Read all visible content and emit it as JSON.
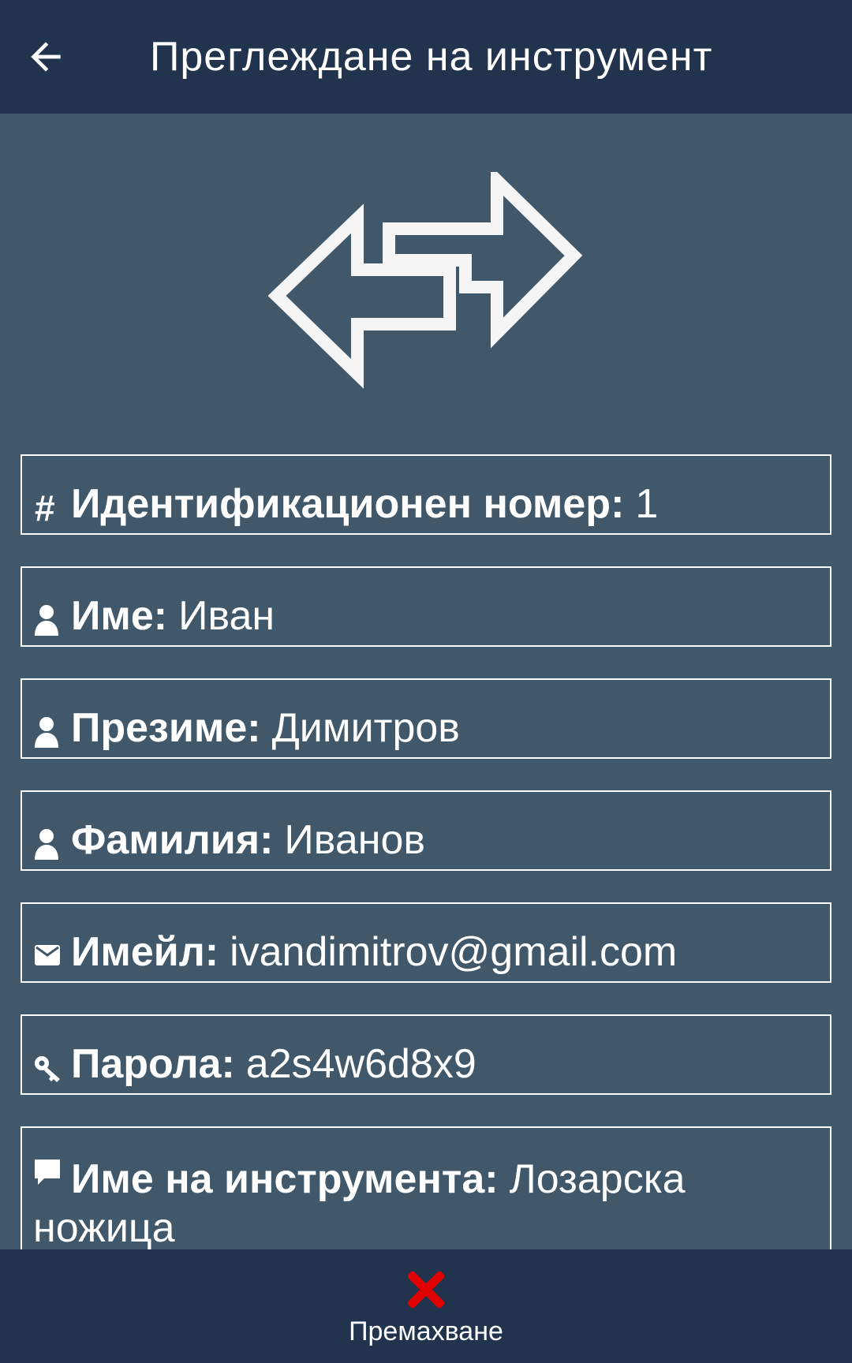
{
  "app_bar": {
    "title": "Преглеждане на инструмент",
    "back_icon": "arrow-left-icon"
  },
  "hero": {
    "icon": "swap-arrows-icon",
    "color": "#f5f5f5"
  },
  "fields": [
    {
      "icon": "hash-icon",
      "label": "Идентификационен номер:",
      "value": "1"
    },
    {
      "icon": "person-icon",
      "label": "Име:",
      "value": "Иван"
    },
    {
      "icon": "person-icon",
      "label": "Презиме:",
      "value": "Димитров"
    },
    {
      "icon": "person-icon",
      "label": "Фамилия:",
      "value": "Иванов"
    },
    {
      "icon": "mail-icon",
      "label": "Имейл:",
      "value": "ivandimitrov@gmail.com"
    },
    {
      "icon": "key-icon",
      "label": "Парола:",
      "value": "a2s4w6d8x9"
    },
    {
      "icon": "comment-icon",
      "label": "Име на инструмента:",
      "value": "Лозарска ножица"
    }
  ],
  "bottom_bar": {
    "remove_label": "Премахване",
    "remove_icon": "close-x-icon",
    "remove_color": "#e00000"
  },
  "colors": {
    "background": "#41586a",
    "bars": "#22344d",
    "text": "#ffffff"
  }
}
